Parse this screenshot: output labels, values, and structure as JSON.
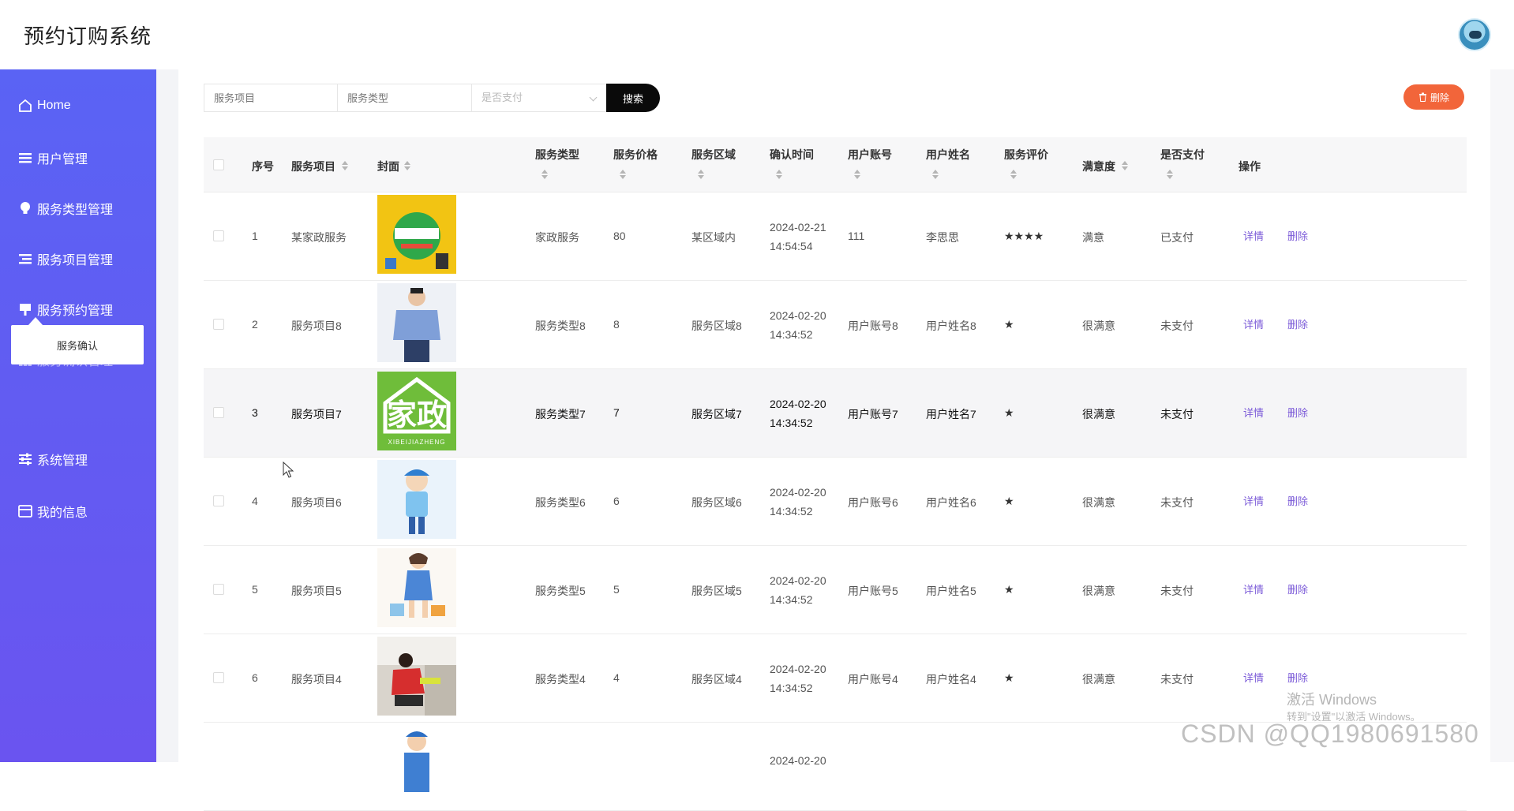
{
  "app": {
    "title": "预约订购系统"
  },
  "sidebar": {
    "items": [
      {
        "label": "Home",
        "icon": "home-icon"
      },
      {
        "label": "用户管理",
        "icon": "list-icon"
      },
      {
        "label": "服务类型管理",
        "icon": "bulb-icon"
      },
      {
        "label": "服务项目管理",
        "icon": "list-icon"
      },
      {
        "label": "服务预约管理",
        "icon": "flag-icon"
      },
      {
        "label": "服务确认管理",
        "icon": "grid-icon"
      },
      {
        "label": "系统管理",
        "icon": "sliders-icon"
      },
      {
        "label": "我的信息",
        "icon": "card-icon"
      }
    ],
    "submenu_label": "服务确认"
  },
  "search": {
    "item_placeholder": "服务项目",
    "type_placeholder": "服务类型",
    "paid_placeholder": "是否支付",
    "button_label": "搜索"
  },
  "toolbar": {
    "delete_label": "删除"
  },
  "table": {
    "headers": [
      "序号",
      "服务项目",
      "封面",
      "服务类型",
      "服务价格",
      "服务区域",
      "确认时间",
      "用户账号",
      "用户姓名",
      "服务评价",
      "满意度",
      "是否支付",
      "操作"
    ],
    "detail_label": "详情",
    "delete_label": "删除",
    "rows": [
      {
        "no": "1",
        "item": "某家政服务",
        "type": "家政服务",
        "price": "80",
        "area": "某区域内",
        "date": "2024-02-21",
        "time": "14:54:54",
        "account": "111",
        "name": "李思思",
        "rating": "★★★★",
        "satisfaction": "满意",
        "paid": "已支付",
        "cover": "banner"
      },
      {
        "no": "2",
        "item": "服务项目8",
        "type": "服务类型8",
        "price": "8",
        "area": "服务区域8",
        "date": "2024-02-20",
        "time": "14:34:52",
        "account": "用户账号8",
        "name": "用户姓名8",
        "rating": "★",
        "satisfaction": "很满意",
        "paid": "未支付",
        "cover": "uniform"
      },
      {
        "no": "3",
        "item": "服务项目7",
        "type": "服务类型7",
        "price": "7",
        "area": "服务区域7",
        "date": "2024-02-20",
        "time": "14:34:52",
        "account": "用户账号7",
        "name": "用户姓名7",
        "rating": "★",
        "satisfaction": "很满意",
        "paid": "未支付",
        "cover": "logo",
        "logo_text": "家政",
        "logo_sub": "XIBEIJIAZHENG"
      },
      {
        "no": "4",
        "item": "服务项目6",
        "type": "服务类型6",
        "price": "6",
        "area": "服务区域6",
        "date": "2024-02-20",
        "time": "14:34:52",
        "account": "用户账号6",
        "name": "用户姓名6",
        "rating": "★",
        "satisfaction": "很满意",
        "paid": "未支付",
        "cover": "cleaner-boy"
      },
      {
        "no": "5",
        "item": "服务项目5",
        "type": "服务类型5",
        "price": "5",
        "area": "服务区域5",
        "date": "2024-02-20",
        "time": "14:34:52",
        "account": "用户账号5",
        "name": "用户姓名5",
        "rating": "★",
        "satisfaction": "很满意",
        "paid": "未支付",
        "cover": "cleaner-girl"
      },
      {
        "no": "6",
        "item": "服务项目4",
        "type": "服务类型4",
        "price": "4",
        "area": "服务区域4",
        "date": "2024-02-20",
        "time": "14:34:52",
        "account": "用户账号4",
        "name": "用户姓名4",
        "rating": "★",
        "satisfaction": "很满意",
        "paid": "未支付",
        "cover": "cleaning-photo"
      },
      {
        "date": "2024-02-20",
        "cover": "worker"
      }
    ]
  },
  "overlay": {
    "activation_title": "激活 Windows",
    "activation_hint": "转到\"设置\"以激活 Windows。",
    "csdn": "CSDN @QQ1980691580"
  },
  "colors": {
    "sidebar_top": "#5a63f4",
    "sidebar_bottom": "#6a54f0",
    "accent_link": "#7b5ad8",
    "danger": "#f2653a"
  }
}
